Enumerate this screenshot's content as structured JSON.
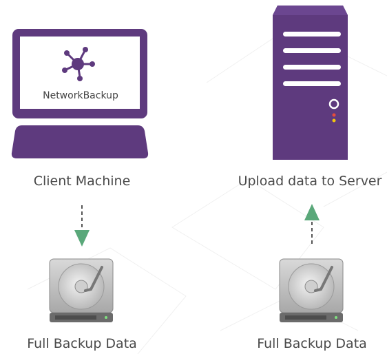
{
  "client": {
    "app_name": "NetworkBackup",
    "label": "Client Machine"
  },
  "server": {
    "label": "Upload data to Server"
  },
  "left_disk": {
    "label": "Full Backup Data"
  },
  "right_disk": {
    "label": "Full Backup Data"
  },
  "colors": {
    "purple": "#5e3a7e",
    "arrow_green": "#5aa87a",
    "label_gray": "#4a4a4a"
  },
  "icons": {
    "client": "desktop-monitor-icon",
    "app_logo": "network-nodes-icon",
    "server": "server-tower-icon",
    "left_disk": "hard-drive-icon",
    "right_disk": "hard-drive-icon",
    "down_arrow": "arrow-down-icon",
    "up_arrow": "arrow-up-icon"
  }
}
